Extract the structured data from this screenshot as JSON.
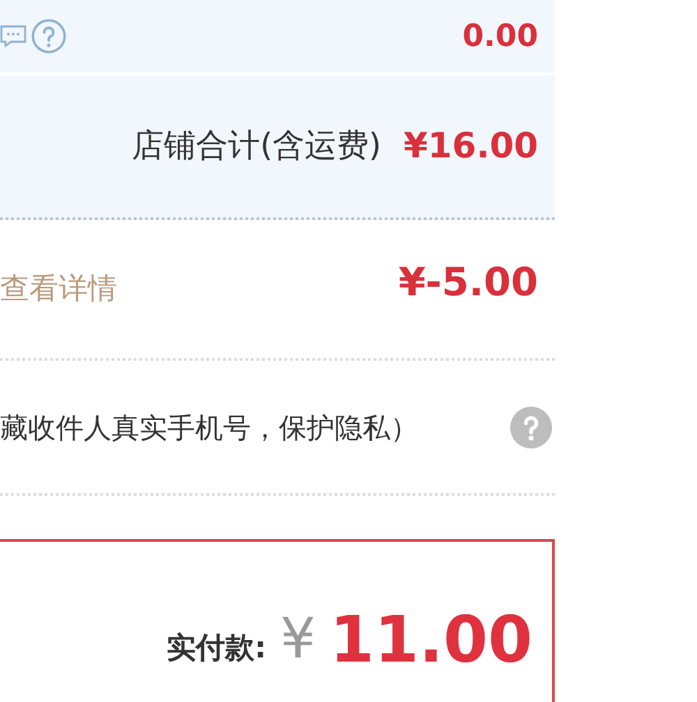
{
  "discount_row": {
    "amount": "0.00"
  },
  "shop_total": {
    "label": "店铺合计(含运费)",
    "amount": "¥16.00"
  },
  "promotion": {
    "link": "查看详情",
    "amount": "¥-5.00"
  },
  "privacy": {
    "text": "藏收件人真实手机号，保护隐私）"
  },
  "payment": {
    "label": "实付款:",
    "currency": "¥",
    "amount": "11.00"
  }
}
